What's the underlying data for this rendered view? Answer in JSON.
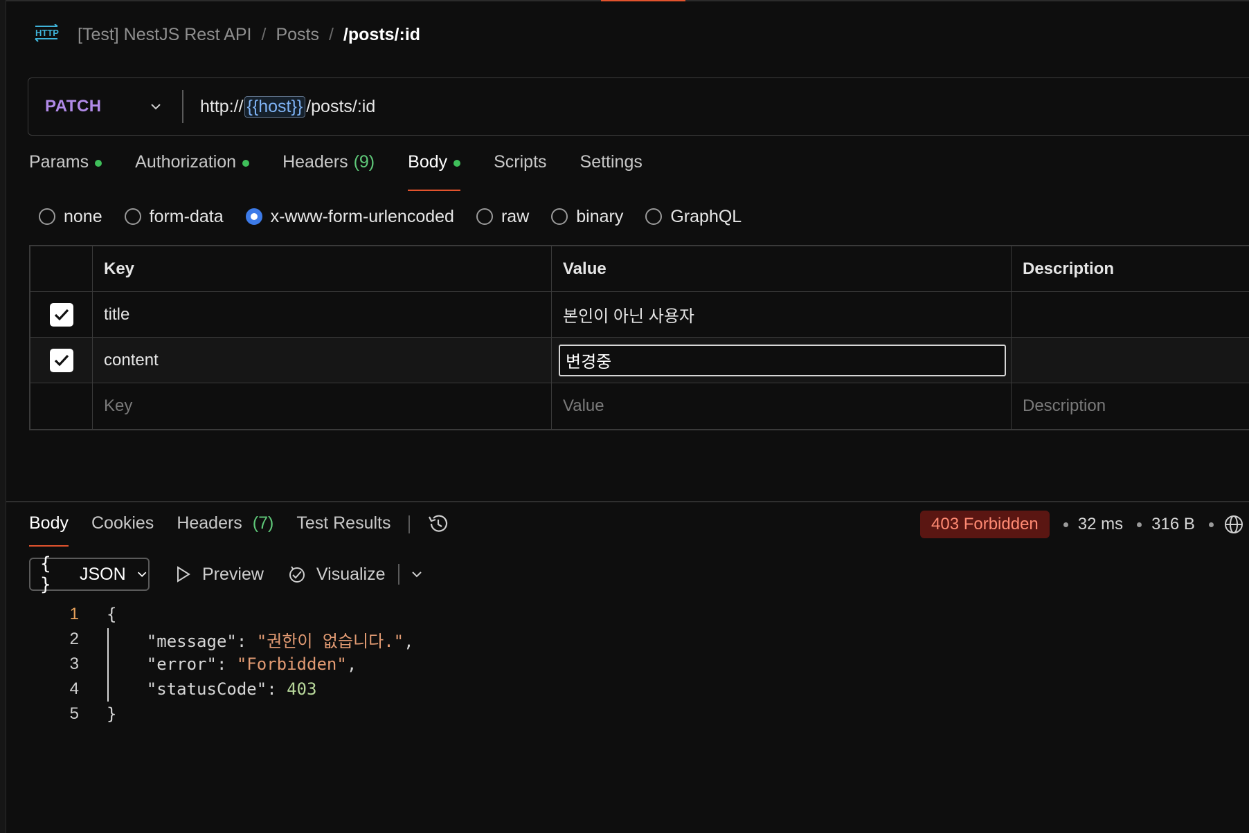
{
  "breadcrumb": {
    "icon": "http-icon",
    "collection": "[Test] NestJS Rest API",
    "folder": "Posts",
    "current": "/posts/:id",
    "separator": "/"
  },
  "request": {
    "method": "PATCH",
    "url_prefix": "http://",
    "url_variable": "{{host}}",
    "url_suffix": "/posts/:id",
    "method_color": "#b18ae8"
  },
  "request_tabs": [
    {
      "label": "Params",
      "dot": true
    },
    {
      "label": "Authorization",
      "dot": true
    },
    {
      "label": "Headers",
      "count": "(9)"
    },
    {
      "label": "Body",
      "dot": true,
      "active": true
    },
    {
      "label": "Scripts"
    },
    {
      "label": "Settings"
    }
  ],
  "body_types": [
    {
      "label": "none",
      "selected": false
    },
    {
      "label": "form-data",
      "selected": false
    },
    {
      "label": "x-www-form-urlencoded",
      "selected": true
    },
    {
      "label": "raw",
      "selected": false
    },
    {
      "label": "binary",
      "selected": false
    },
    {
      "label": "GraphQL",
      "selected": false
    }
  ],
  "table": {
    "headers": {
      "key": "Key",
      "value": "Value",
      "description": "Description"
    },
    "rows": [
      {
        "checked": true,
        "key": "title",
        "value": "본인이 아닌 사용자",
        "description": ""
      },
      {
        "checked": true,
        "key": "content",
        "value": "변경중",
        "description": ""
      }
    ],
    "placeholders": {
      "key": "Key",
      "value": "Value",
      "description": "Description"
    }
  },
  "response_tabs": [
    {
      "label": "Body",
      "active": true
    },
    {
      "label": "Cookies"
    },
    {
      "label": "Headers",
      "count": "(7)"
    },
    {
      "label": "Test Results"
    }
  ],
  "status": {
    "badge": "403 Forbidden",
    "time": "32 ms",
    "size": "316 B",
    "badge_bg": "#5a1612",
    "badge_fg": "#ff8a73"
  },
  "format_bar": {
    "format": "JSON",
    "preview": "Preview",
    "visualize": "Visualize"
  },
  "response_body": {
    "line_numbers": [
      "1",
      "2",
      "3",
      "4",
      "5"
    ],
    "open_brace": "{",
    "close_brace": "}",
    "message_key": "\"message\"",
    "message_value": "\"권한이 없습니다.\"",
    "error_key": "\"error\"",
    "error_value": "\"Forbidden\"",
    "status_key": "\"statusCode\"",
    "status_value": "403"
  }
}
